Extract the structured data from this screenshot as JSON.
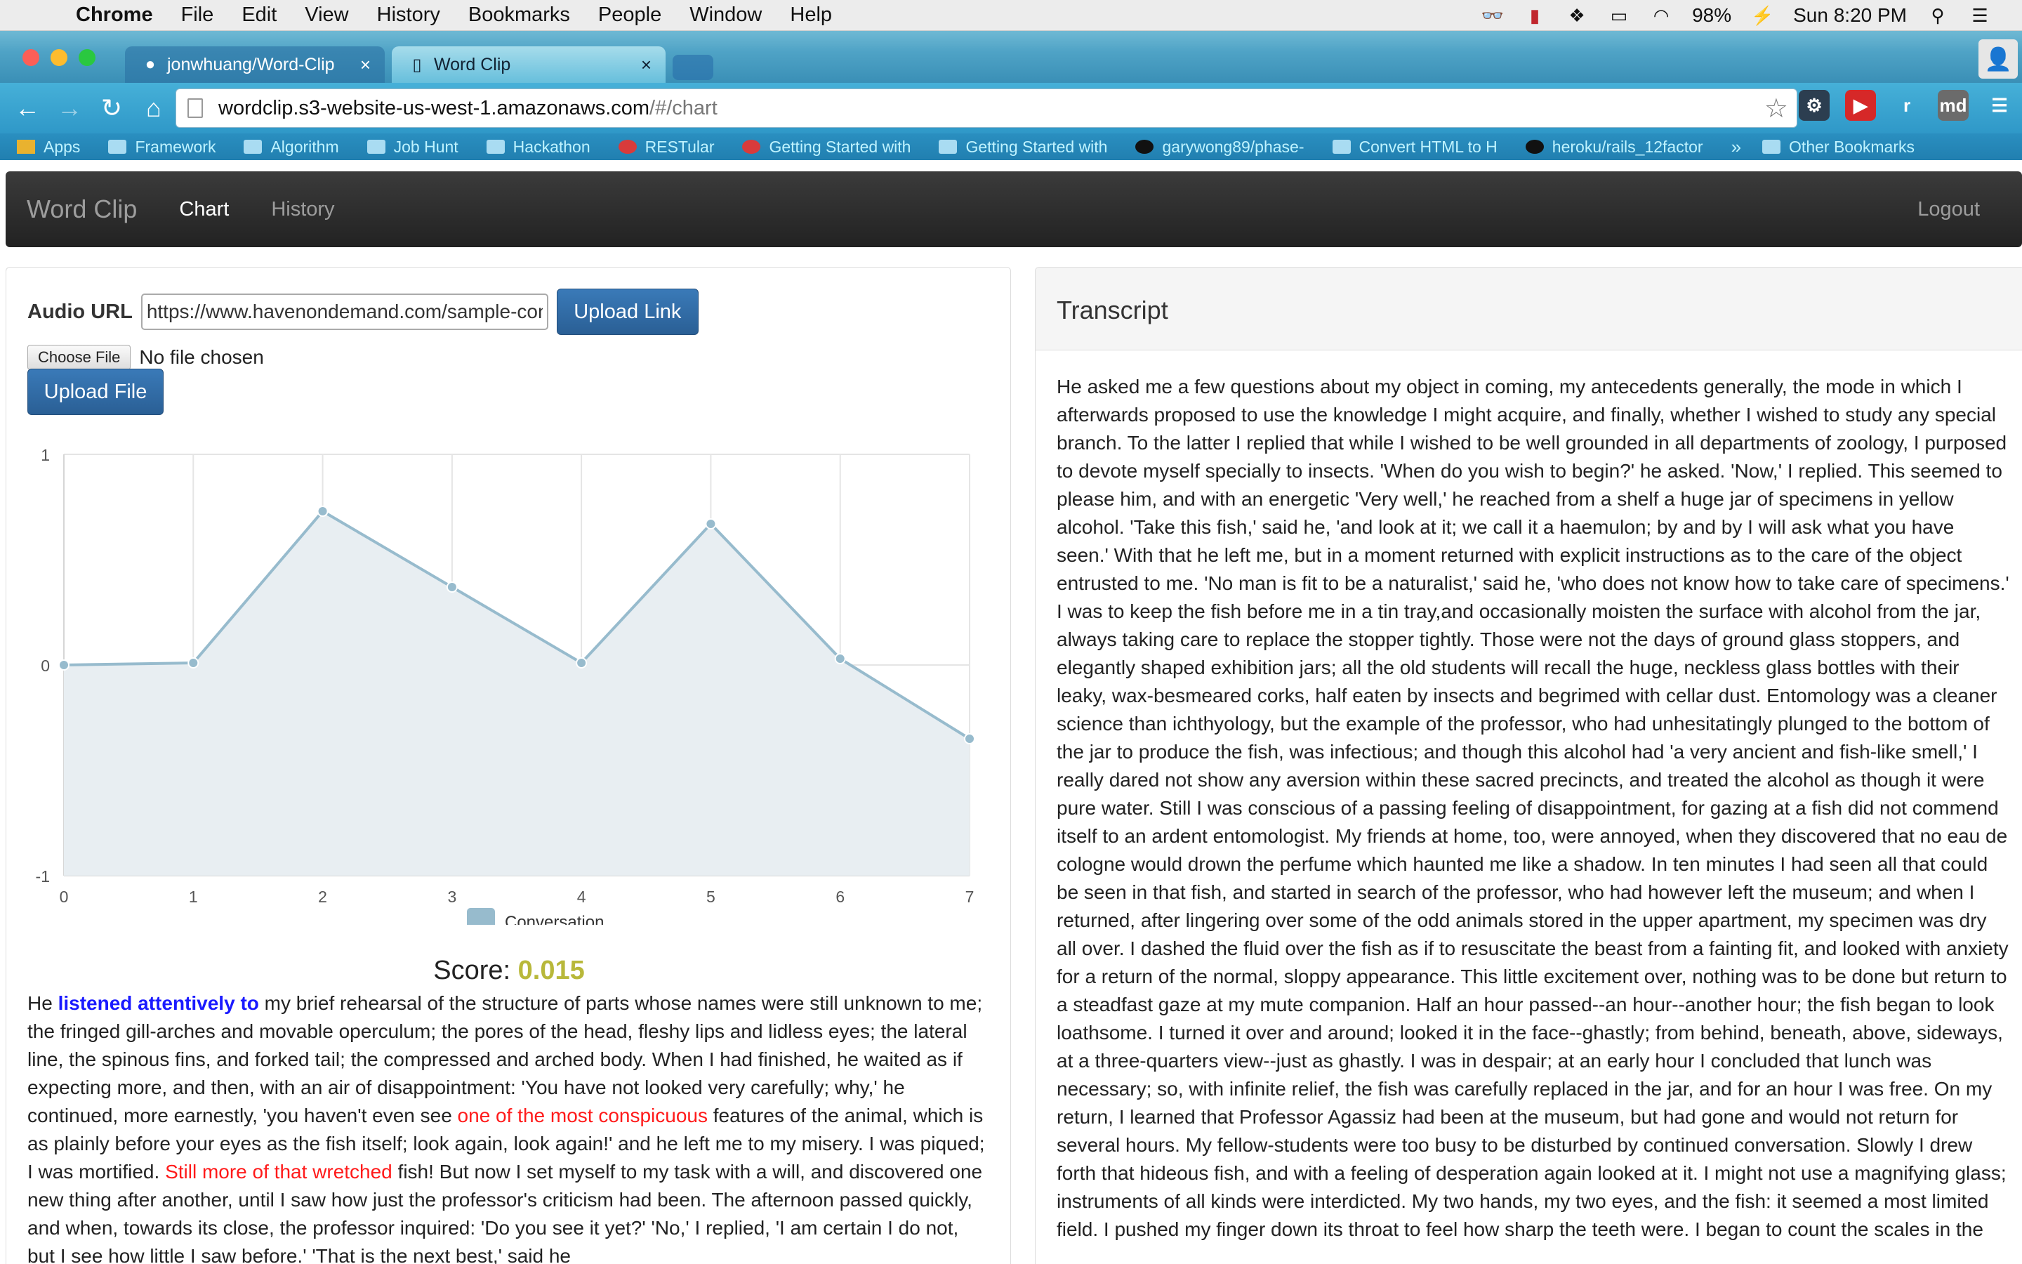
{
  "menubar": {
    "app": "Chrome",
    "items": [
      "File",
      "Edit",
      "View",
      "History",
      "Bookmarks",
      "People",
      "Window",
      "Help"
    ],
    "battery": "98%",
    "clock": "Sun 8:20 PM"
  },
  "tabs": [
    {
      "title": "jonwhuang/Word-Clip",
      "icon": "github-icon"
    },
    {
      "title": "Word Clip",
      "icon": "page-icon"
    }
  ],
  "address": {
    "host": "wordclip.s3-website-us-west-1.amazonaws.com",
    "path": "/#/chart"
  },
  "extensions": [
    {
      "icon": "gear-icon",
      "glyph": "⚙",
      "color": "#2c3e50"
    },
    {
      "icon": "youtube-icon",
      "glyph": "▶",
      "color": "#d62828"
    },
    {
      "icon": "r-icon",
      "glyph": "r",
      "color": "transparent"
    },
    {
      "icon": "md-icon",
      "glyph": "md",
      "color": "#6b6b6b"
    },
    {
      "icon": "chrome-menu-icon",
      "glyph": "☰",
      "color": "transparent"
    }
  ],
  "bookmarks": [
    {
      "label": "Apps",
      "type": "grid"
    },
    {
      "label": "Framework",
      "type": "folder"
    },
    {
      "label": "Algorithm",
      "type": "folder"
    },
    {
      "label": "Job Hunt",
      "type": "folder"
    },
    {
      "label": "Hackathon",
      "type": "folder"
    },
    {
      "label": "RESTular",
      "type": "red"
    },
    {
      "label": "Getting Started with",
      "type": "red"
    },
    {
      "label": "Getting Started with",
      "type": "folder"
    },
    {
      "label": "garywong89/phase-",
      "type": "gh"
    },
    {
      "label": "Convert HTML to H",
      "type": "folder"
    },
    {
      "label": "heroku/rails_12factor",
      "type": "gh"
    }
  ],
  "bookmarks_overflow": "»",
  "bookmarks_other": "Other Bookmarks",
  "app": {
    "brand": "Word Clip",
    "nav": [
      "Chart",
      "History"
    ],
    "logout": "Logout"
  },
  "upload": {
    "audio_label": "Audio URL",
    "audio_value": "https://www.havenondemand.com/sample-content",
    "upload_link": "Upload Link",
    "choose_file": "Choose File",
    "no_file": "No file chosen",
    "upload_file": "Upload File"
  },
  "chart_data": {
    "type": "area",
    "x": [
      0,
      1,
      2,
      3,
      4,
      5,
      6,
      7
    ],
    "series": [
      {
        "name": "Conversation",
        "values": [
          0.0,
          0.01,
          0.73,
          0.37,
          0.01,
          0.67,
          0.03,
          -0.35
        ]
      }
    ],
    "xlim": [
      0,
      7
    ],
    "ylim": [
      -1,
      1
    ],
    "yticks": [
      1,
      0,
      -1
    ],
    "xticks": [
      0,
      1,
      2,
      3,
      4,
      5,
      6,
      7
    ],
    "grid": true,
    "legend": "bottom",
    "color": "#97bbcd",
    "fill": "#e8eef2"
  },
  "score": {
    "label": "Score:",
    "value": "0.015"
  },
  "summary": {
    "p1": "He ",
    "h1": "listened attentively to",
    "p2": " my brief rehearsal of the structure of parts whose names were still unknown to me; the fringed gill-arches and movable operculum; the pores of the head, fleshy lips and lidless eyes; the lateral line, the spinous fins, and forked tail; the compressed and arched body. When I had finished, he waited as if expecting more, and then, with an air of disappointment: 'You have not looked very carefully; why,' he continued, more earnestly, 'you haven't even see ",
    "h2": "one of the most conspicuous",
    "p3": " features of the animal, which is as plainly before your eyes as the fish itself; look again, look again!' and he left me to my misery. I was piqued; I was mortified. ",
    "h3": "Still more of that wretched",
    "p4": " fish! But now I set myself to my task with a will, and discovered one new thing after another, until I saw how just the professor's criticism had been. The afternoon passed quickly, and when, towards its close, the professor inquired: 'Do you see it yet?' 'No,' I replied, 'I am certain I do not, but I see how little I saw before.' 'That is the next best,' said he"
  },
  "transcript": {
    "title": "Transcript",
    "text": "He asked me a few questions about my object in coming, my antecedents generally, the mode in which I afterwards proposed to use the knowledge I might acquire, and finally, whether I wished to study any special branch. To the latter I replied that while I wished to be well grounded in all departments of zoology, I purposed to devote myself specially to insects. 'When do you wish to begin?' he asked. 'Now,' I replied. This seemed to please him, and with an energetic 'Very well,' he reached from a shelf a huge jar of specimens in yellow alcohol. 'Take this fish,' said he, 'and look at it; we call it a haemulon; by and by I will ask what you have seen.' With that he left me, but in a moment returned with explicit instructions as to the care of the object entrusted to me. 'No man is fit to be a naturalist,' said he, 'who does not know how to take care of specimens.' I was to keep the fish before me in a tin tray,and occasionally moisten the surface with alcohol from the jar, always taking care to replace the stopper tightly. Those were not the days of ground glass stoppers, and elegantly shaped exhibition jars; all the old students will recall the huge, neckless glass bottles with their leaky, wax-besmeared corks, half eaten by insects and begrimed with cellar dust. Entomology was a cleaner science than ichthyology, but the example of the professor, who had unhesitatingly plunged to the bottom of the jar to produce the fish, was infectious; and though this alcohol had 'a very ancient and fish-like smell,' I really dared not show any aversion within these sacred precincts, and treated the alcohol as though it were pure water. Still I was conscious of a passing feeling of disappointment, for gazing at a fish did not commend itself to an ardent entomologist. My friends at home, too, were annoyed, when they discovered that no eau de cologne would drown the perfume which haunted me like a shadow. In ten minutes I had seen all that could be seen in that fish, and started in search of the professor, who had however left the museum; and when I returned, after lingering over some of the odd animals stored in the upper apartment, my specimen was dry all over. I dashed the fluid over the fish as if to resuscitate the beast from a fainting fit, and looked with anxiety for a return of the normal, sloppy appearance. This little excitement over, nothing was to be done but return to a steadfast gaze at my mute companion. Half an hour passed--an hour--another hour; the fish began to look loathsome. I turned it over and around; looked it in the face--ghastly; from behind, beneath, above, sideways, at a three-quarters view--just as ghastly. I was in despair; at an early hour I concluded that lunch was necessary; so, with infinite relief, the fish was carefully replaced in the jar, and for an hour I was free. On my return, I learned that Professor Agassiz had been at the museum, but had gone and would not return for several hours. My fellow-students were too busy to be disturbed by continued conversation. Slowly I drew forth that hideous fish, and with a feeling of desperation again looked at it. I might not use a magnifying glass; instruments of all kinds were interdicted. My two hands, my two eyes, and the fish: it seemed a most limited field. I pushed my finger down its throat to feel how sharp the teeth were. I began to count the scales in the"
  }
}
